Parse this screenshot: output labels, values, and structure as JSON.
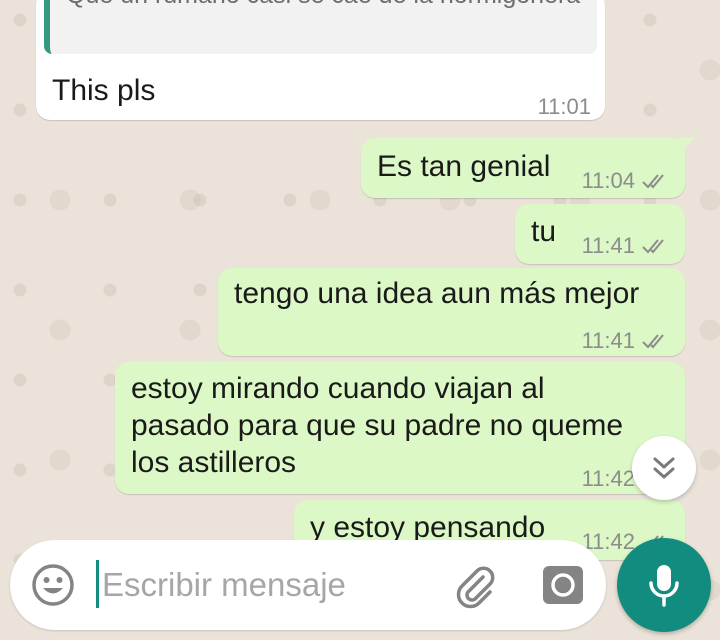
{
  "chat": {
    "incoming": {
      "quote_text": "Que un rumano casi se cae de la hormigonera",
      "text": "This pls",
      "time": "11:01"
    },
    "outgoing": [
      {
        "text": "Es tan genial",
        "time": "11:04"
      },
      {
        "text": "tu",
        "time": "11:41"
      },
      {
        "text": "tengo una idea aun más mejor",
        "time": "11:41"
      },
      {
        "line1": "estoy mirando cuando viajan al",
        "line2": "pasado para que su padre no queme",
        "line3": "los astilleros",
        "time": "11:42"
      },
      {
        "text": "y estoy pensando",
        "time": "11:42"
      }
    ],
    "read_status_icon": "double-check-icon"
  },
  "composer": {
    "placeholder": "Escribir mensaje",
    "value": "",
    "icons": {
      "emoji": "smiley-icon",
      "attach": "paperclip-icon",
      "camera": "camera-icon",
      "mic": "microphone-icon",
      "scroll": "double-chevron-down-icon"
    }
  },
  "colors": {
    "outgoing_bubble": "#dcf8c6",
    "incoming_bubble": "#ffffff",
    "accent": "#128c7e",
    "quote_bar": "#35987f",
    "timestamp": "#8c8c8c"
  }
}
